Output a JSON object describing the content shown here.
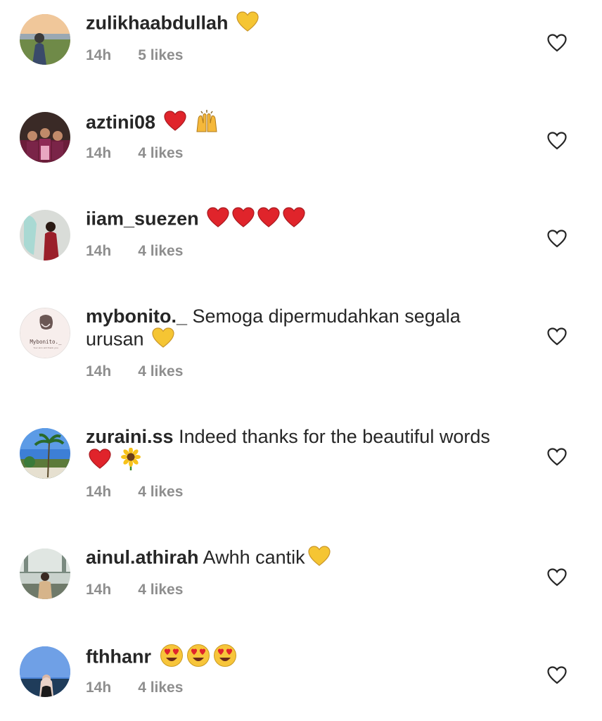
{
  "comments": [
    {
      "username": "zulikhaabdullah",
      "text": "",
      "time": "14h",
      "likes": "5 likes",
      "emojis": [
        "yellow-heart"
      ]
    },
    {
      "username": "aztini08",
      "text": "",
      "time": "14h",
      "likes": "4 likes",
      "emojis": [
        "red-heart",
        "raising-hands"
      ]
    },
    {
      "username": "iiam_suezen",
      "text": "",
      "time": "14h",
      "likes": "4 likes",
      "emojis": [
        "red-heart",
        "red-heart",
        "red-heart",
        "red-heart"
      ]
    },
    {
      "username": "mybonito._",
      "text": "Semoga dipermudahkan segala urusan",
      "time": "14h",
      "likes": "4 likes",
      "emojis": [
        "yellow-heart"
      ],
      "avatar_text": "Mybonito._",
      "avatar_subtext": "Your skin will thank you"
    },
    {
      "username": "zuraini.ss",
      "text": "Indeed thanks for the beautiful words",
      "time": "14h",
      "likes": "4 likes",
      "emojis": [
        "red-heart",
        "sunflower"
      ]
    },
    {
      "username": "ainul.athirah",
      "text": "Awhh cantik",
      "time": "14h",
      "likes": "4 likes",
      "emojis": [
        "yellow-heart"
      ]
    },
    {
      "username": "fthhanr",
      "text": "",
      "time": "14h",
      "likes": "4 likes",
      "emojis": [
        "heart-eyes-face",
        "heart-eyes-face",
        "heart-eyes-face"
      ]
    }
  ],
  "colors": {
    "username": "#262626",
    "meta": "#8e8e8e",
    "red_heart": "#e0242b",
    "yellow_heart": "#f5c533"
  }
}
